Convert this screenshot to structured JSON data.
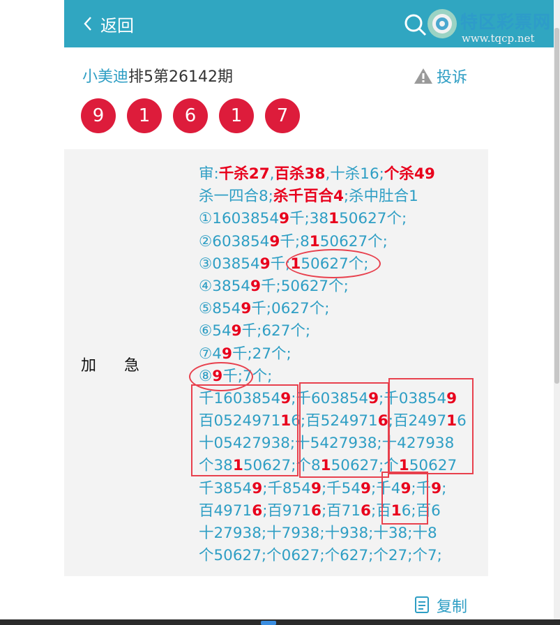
{
  "header": {
    "back_label": "返回"
  },
  "watermark": {
    "title": "特区彩票网",
    "url": "www.tqcp.net"
  },
  "post": {
    "author": "小美迪",
    "title": "排5第26142期",
    "complain_label": "投诉"
  },
  "balls": [
    "9",
    "1",
    "6",
    "1",
    "7"
  ],
  "section": {
    "label_a": "加",
    "label_b": "急"
  },
  "content_lines": [
    [
      [
        "审:",
        0
      ],
      [
        "千杀27",
        1
      ],
      [
        ",",
        0
      ],
      [
        "百杀38",
        1
      ],
      [
        ",十杀16;",
        0
      ],
      [
        "个杀49",
        1
      ]
    ],
    [
      [
        "杀一四合8;",
        0
      ],
      [
        "杀千百合4",
        1
      ],
      [
        ";杀中肚合1",
        0
      ]
    ],
    [
      [
        "①1603854",
        0
      ],
      [
        "9",
        1
      ],
      [
        "千;38",
        0
      ],
      [
        "1",
        1
      ],
      [
        "50627个;",
        0
      ]
    ],
    [
      [
        "②603854",
        0
      ],
      [
        "9",
        1
      ],
      [
        "千;8",
        0
      ],
      [
        "1",
        1
      ],
      [
        "50627个;",
        0
      ]
    ],
    [
      [
        "③03854",
        0
      ],
      [
        "9",
        1
      ],
      [
        "千;",
        0
      ],
      [
        "1",
        1
      ],
      [
        "50627个;",
        0
      ]
    ],
    [
      [
        "④3854",
        0
      ],
      [
        "9",
        1
      ],
      [
        "千;50627个;",
        0
      ]
    ],
    [
      [
        "⑤854",
        0
      ],
      [
        "9",
        1
      ],
      [
        "千;0627个;",
        0
      ]
    ],
    [
      [
        "⑥54",
        0
      ],
      [
        "9",
        1
      ],
      [
        "千;627个;",
        0
      ]
    ],
    [
      [
        "⑦4",
        0
      ],
      [
        "9",
        1
      ],
      [
        "千;27个;",
        0
      ]
    ],
    [
      [
        "⑧",
        0
      ],
      [
        "9",
        1
      ],
      [
        "千;7个;",
        0
      ]
    ],
    [
      [
        "千1603854",
        0
      ],
      [
        "9",
        1
      ],
      [
        ";千603854",
        0
      ],
      [
        "9",
        1
      ],
      [
        ";千03854",
        0
      ],
      [
        "9",
        1
      ]
    ],
    [
      [
        "百0524971",
        0
      ],
      [
        "1",
        1
      ],
      [
        "6;百524971",
        0
      ],
      [
        "6",
        1
      ],
      [
        ";百2497",
        0
      ],
      [
        "1",
        1
      ],
      [
        "6",
        0
      ]
    ],
    [
      [
        "十05427938;十5427938;十427938",
        0
      ]
    ],
    [
      [
        "个38",
        0
      ],
      [
        "1",
        1
      ],
      [
        "50627;个8",
        0
      ],
      [
        "1",
        1
      ],
      [
        "50627;个",
        0
      ],
      [
        "1",
        1
      ],
      [
        "50627",
        0
      ]
    ],
    [
      [
        "千3854",
        0
      ],
      [
        "9",
        1
      ],
      [
        ";千854",
        0
      ],
      [
        "9",
        1
      ],
      [
        ";千54",
        0
      ],
      [
        "9",
        1
      ],
      [
        ";千4",
        0
      ],
      [
        "9",
        1
      ],
      [
        ";千",
        0
      ],
      [
        "9",
        1
      ],
      [
        ";",
        0
      ]
    ],
    [
      [
        "百4971",
        0
      ],
      [
        "6",
        1
      ],
      [
        ";百971",
        0
      ],
      [
        "6",
        1
      ],
      [
        ";百71",
        0
      ],
      [
        "6",
        1
      ],
      [
        ";百",
        0
      ],
      [
        "1",
        1
      ],
      [
        "6;百6",
        0
      ]
    ],
    [
      [
        "十27938;十7938;十938;十38;十8",
        0
      ]
    ],
    [
      [
        "个50627;个0627;个627;个27;个7;",
        0
      ]
    ]
  ],
  "copy_label": "复制"
}
